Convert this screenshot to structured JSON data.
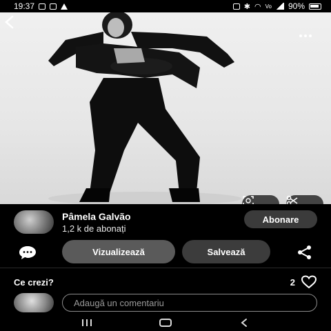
{
  "status_bar": {
    "time": "19:37",
    "battery_percent": "90%",
    "icons": [
      "gallery-icon",
      "mail-icon",
      "warning-icon",
      "nfc-icon",
      "bluetooth-icon",
      "wifi-icon",
      "volte-icon",
      "signal-icon",
      "battery-icon"
    ]
  },
  "photo": {
    "alt_description": "black and white fashion photo",
    "actions": {
      "lens_icon": "visual-search-icon",
      "crop_icon": "scissors-icon"
    }
  },
  "header": {
    "back_icon": "back-arrow-icon",
    "more_icon": "more-dots-icon"
  },
  "creator": {
    "name": "Pâmela Galvão",
    "followers": "1,2 k de abonați",
    "subscribe_label": "Abonare"
  },
  "actions": {
    "comment_icon": "comment-bubble-icon",
    "view_label": "Vizualizează",
    "save_label": "Salvează",
    "share_icon": "share-icon"
  },
  "comments": {
    "title": "Ce crezi?",
    "likes_count": "2",
    "input_placeholder": "Adaugă un comentariu"
  },
  "colors": {
    "background": "#000000",
    "button_primary": "#5a5a5a",
    "button_secondary": "#3c3c3c",
    "input_border": "#8c8c8c"
  }
}
